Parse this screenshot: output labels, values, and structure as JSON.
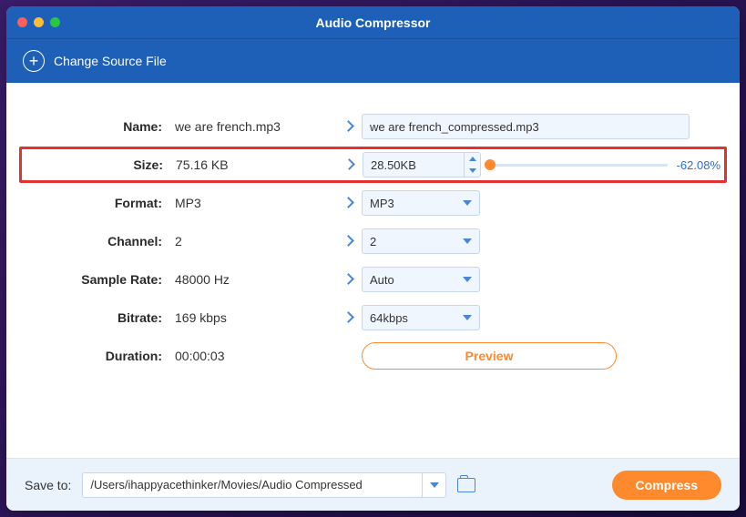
{
  "window": {
    "title": "Audio Compressor"
  },
  "toolbar": {
    "change_source": "Change Source File"
  },
  "rows": {
    "name": {
      "label": "Name:",
      "orig": "we are french.mp3",
      "out": "we are french_compressed.mp3"
    },
    "size": {
      "label": "Size:",
      "orig": "75.16 KB",
      "out": "28.50KB",
      "pct": "-62.08%"
    },
    "format": {
      "label": "Format:",
      "orig": "MP3",
      "out": "MP3"
    },
    "channel": {
      "label": "Channel:",
      "orig": "2",
      "out": "2"
    },
    "sample": {
      "label": "Sample Rate:",
      "orig": "48000 Hz",
      "out": "Auto"
    },
    "bitrate": {
      "label": "Bitrate:",
      "orig": "169 kbps",
      "out": "64kbps"
    },
    "duration": {
      "label": "Duration:",
      "orig": "00:00:03"
    }
  },
  "buttons": {
    "preview": "Preview",
    "compress": "Compress"
  },
  "footer": {
    "save_label": "Save to:",
    "path": "/Users/ihappyacethinker/Movies/Audio Compressed"
  }
}
